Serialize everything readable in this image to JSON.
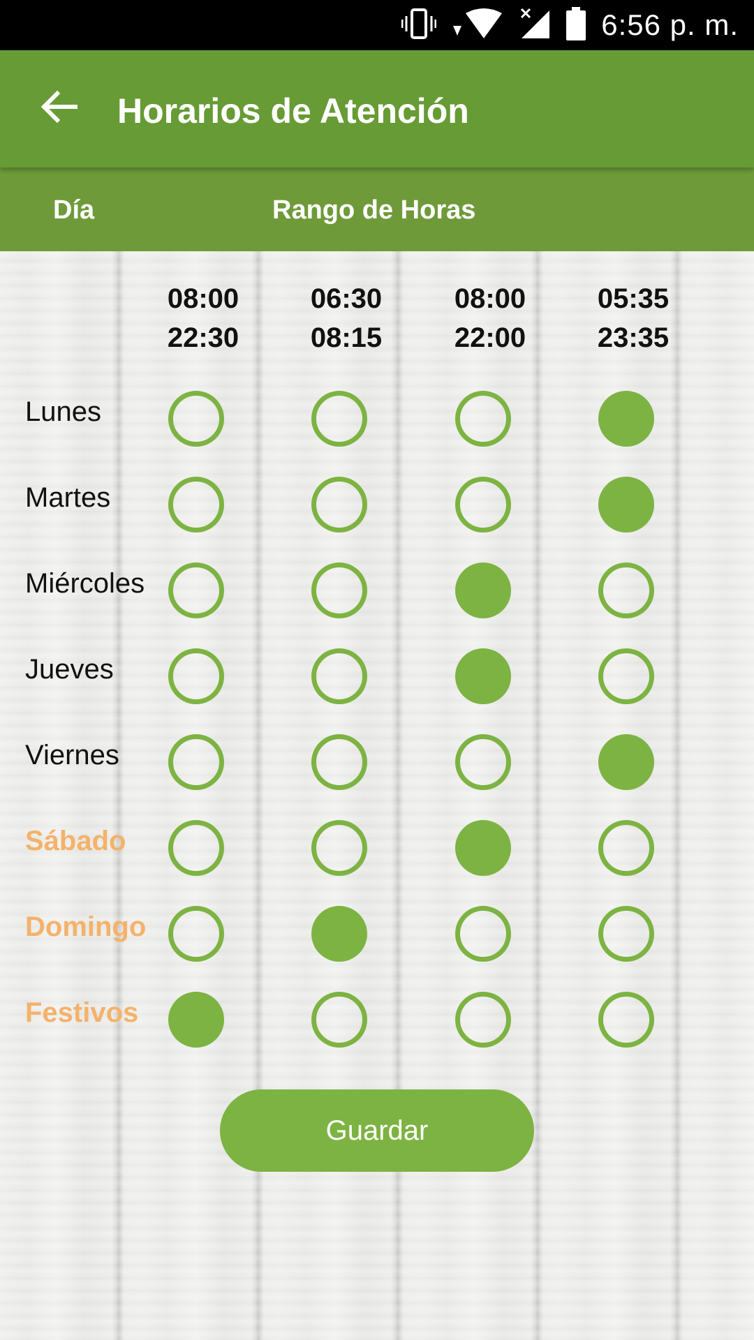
{
  "status_bar": {
    "time": "6:56 p. m.",
    "icons": [
      "vibrate-icon",
      "wifi-icon",
      "signal-icon",
      "battery-icon"
    ]
  },
  "app_bar": {
    "title": "Horarios de Atención",
    "back_icon": "arrow-left-icon"
  },
  "table_header": {
    "day": "Día",
    "range": "Rango de Horas"
  },
  "time_ranges": [
    {
      "start": "08:00",
      "end": "22:30"
    },
    {
      "start": "06:30",
      "end": "08:15"
    },
    {
      "start": "08:00",
      "end": "22:00"
    },
    {
      "start": "05:35",
      "end": "23:35"
    }
  ],
  "days": [
    {
      "label": "Lunes",
      "weekend": false,
      "selected": 3
    },
    {
      "label": "Martes",
      "weekend": false,
      "selected": 3
    },
    {
      "label": "Miércoles",
      "weekend": false,
      "selected": 2
    },
    {
      "label": "Jueves",
      "weekend": false,
      "selected": 2
    },
    {
      "label": "Viernes",
      "weekend": false,
      "selected": 3
    },
    {
      "label": "Sábado",
      "weekend": true,
      "selected": 2
    },
    {
      "label": "Domingo",
      "weekend": true,
      "selected": 1
    },
    {
      "label": "Festivos",
      "weekend": true,
      "selected": 0
    }
  ],
  "save_button": {
    "label": "Guardar"
  },
  "colors": {
    "primary": "#679b35",
    "header": "#6f9a3a",
    "accent": "#7db342",
    "weekend": "#f4b26a"
  }
}
